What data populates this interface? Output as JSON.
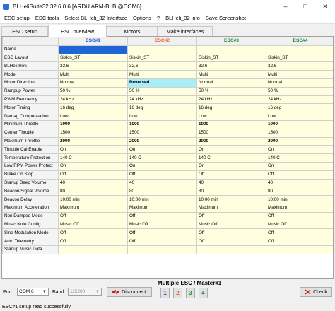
{
  "window": {
    "title": "BLHeliSuite32 32.6.0.6  [ARDU ARM-BLB @COM6]",
    "minimize_icon": "minimize-icon",
    "maximize_icon": "maximize-icon",
    "close_icon": "close-icon"
  },
  "menu": [
    "ESC setup",
    "ESC tools",
    "Select BLHeli_32 Interface",
    "Options",
    "?",
    "BLHeli_32 info",
    "Save Screenshot"
  ],
  "tabs": [
    "ESC setup",
    "ESC overview",
    "Motors",
    "Make interfaces"
  ],
  "active_tab": "ESC overview",
  "grid": {
    "columns": [
      "ESC#1",
      "ESC#2",
      "ESC#3",
      "ESC#4"
    ],
    "column_colors": [
      "#1e4fd8",
      "#e8622c",
      "#1a8a2a",
      "#1a8a2a"
    ],
    "rows": [
      {
        "label": "Name",
        "values": [
          "",
          "",
          "",
          ""
        ]
      },
      {
        "label": "ESC Layout",
        "values": [
          "Siskin_ST",
          "Siskin_ST",
          "Siskin_ST",
          "Siskin_ST"
        ]
      },
      {
        "label": "BLHeli Rev.",
        "values": [
          "32.6",
          "32.6",
          "32.6",
          "32.6"
        ]
      },
      {
        "label": "Mode",
        "values": [
          "Multi",
          "Multi",
          "Multi",
          "Multi"
        ]
      },
      {
        "label": "Motor Direction",
        "values": [
          "Normal",
          "Reversed",
          "Normal",
          "Normal"
        ]
      },
      {
        "label": "Rampup Power",
        "values": [
          "50 %",
          "50 %",
          "50 %",
          "50 %"
        ]
      },
      {
        "label": "PWM Frequency",
        "values": [
          "24 kHz",
          "24 kHz",
          "24 kHz",
          "24 kHz"
        ]
      },
      {
        "label": "Motor Timing",
        "values": [
          "16 deg",
          "16 deg",
          "16 deg",
          "16 deg"
        ]
      },
      {
        "label": "Demag Compensation",
        "values": [
          "Low",
          "Low",
          "Low",
          "Low"
        ]
      },
      {
        "label": "Minimum Throttle",
        "values": [
          "1000",
          "1000",
          "1000",
          "1000"
        ]
      },
      {
        "label": "Center Throttle",
        "values": [
          "1500",
          "1500",
          "1500",
          "1500"
        ]
      },
      {
        "label": "Maximum Throttle",
        "values": [
          "2000",
          "2000",
          "2000",
          "2000"
        ]
      },
      {
        "label": "Throttle Cal Enable",
        "values": [
          "On",
          "On",
          "On",
          "On"
        ]
      },
      {
        "label": "Temperature Protection",
        "values": [
          "140 C",
          "140 C",
          "140 C",
          "140 C"
        ]
      },
      {
        "label": "Low RPM Power Protect",
        "values": [
          "On",
          "On",
          "On",
          "On"
        ]
      },
      {
        "label": "Brake On Stop",
        "values": [
          "Off",
          "Off",
          "Off",
          "Off"
        ]
      },
      {
        "label": "Startup Beep Volume",
        "values": [
          "40",
          "40",
          "40",
          "40"
        ]
      },
      {
        "label": "Beacon/Signal Volume",
        "values": [
          "80",
          "80",
          "80",
          "80"
        ]
      },
      {
        "label": "Beacon Delay",
        "values": [
          "10:00 min",
          "10:00 min",
          "10:00 min",
          "10:00 min"
        ]
      },
      {
        "label": "Maximum Acceleration",
        "values": [
          "Maximum",
          "Maximum",
          "Maximum",
          "Maximum"
        ]
      },
      {
        "label": "Non Damped Mode",
        "values": [
          "Off",
          "Off",
          "Off",
          "Off"
        ]
      },
      {
        "label": "Music Note Config",
        "values": [
          "Music Off",
          "Music Off",
          "Music Off",
          "Music Off"
        ]
      },
      {
        "label": "Sine Modulation Mode",
        "values": [
          "Off",
          "Off",
          "Off",
          "Off"
        ]
      },
      {
        "label": "Auto Telemetry",
        "values": [
          "Off",
          "Off",
          "Off",
          "Off"
        ]
      },
      {
        "label": "Startup Music Data",
        "values": [
          "",
          "",
          "",
          ""
        ]
      }
    ]
  },
  "bottom": {
    "port_label": "Port:",
    "port_value": "COM 6",
    "baud_label": "Baud:",
    "baud_value": "115200",
    "disconnect_label": "Disconnect",
    "master_label": "Multiple ESC / Master#1",
    "esc_buttons": [
      "1",
      "2",
      "3",
      "4"
    ],
    "esc_button_colors": [
      "#1e4fd8",
      "#e8622c",
      "#1a8a2a",
      "#1a8a2a"
    ],
    "check_label": "Check"
  },
  "status": "ESC#1 setup read successfully"
}
